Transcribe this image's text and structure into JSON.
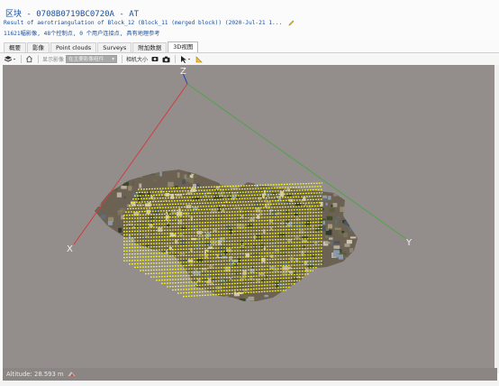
{
  "header": {
    "block_title": "区块 - 0708B0719BC0720A - AT",
    "subtitle": "Result of aerotriangulation of Block_12 (Block_11 (merged block)) (2020-Jul-21 1...",
    "info": "11621幅影像, 48个控制点, 0 个用户连接点, 具有地理参考"
  },
  "tabs": [
    {
      "label": "概要"
    },
    {
      "label": "影像"
    },
    {
      "label": "Point clouds"
    },
    {
      "label": "Surveys"
    },
    {
      "label": "附加数据"
    },
    {
      "label": "3D视图"
    }
  ],
  "active_tab": "3D视图",
  "toolbar": {
    "show_images_label": "显示影像",
    "image_component_select": "在主要影像组件",
    "camera_size_label": "相机大小"
  },
  "viewport": {
    "axis_x": "X",
    "axis_y": "Y",
    "axis_z": "Z",
    "axis_x_color": "#d23c3c",
    "axis_y_color": "#4fa34a",
    "axis_z_color": "#2a3fbf",
    "background_color": "#938e8c",
    "camera_color": "#f5f523"
  },
  "status": {
    "altitude_text": "Altitude: 28.593 m"
  },
  "colors": {
    "title_blue": "#1a4f9c"
  }
}
